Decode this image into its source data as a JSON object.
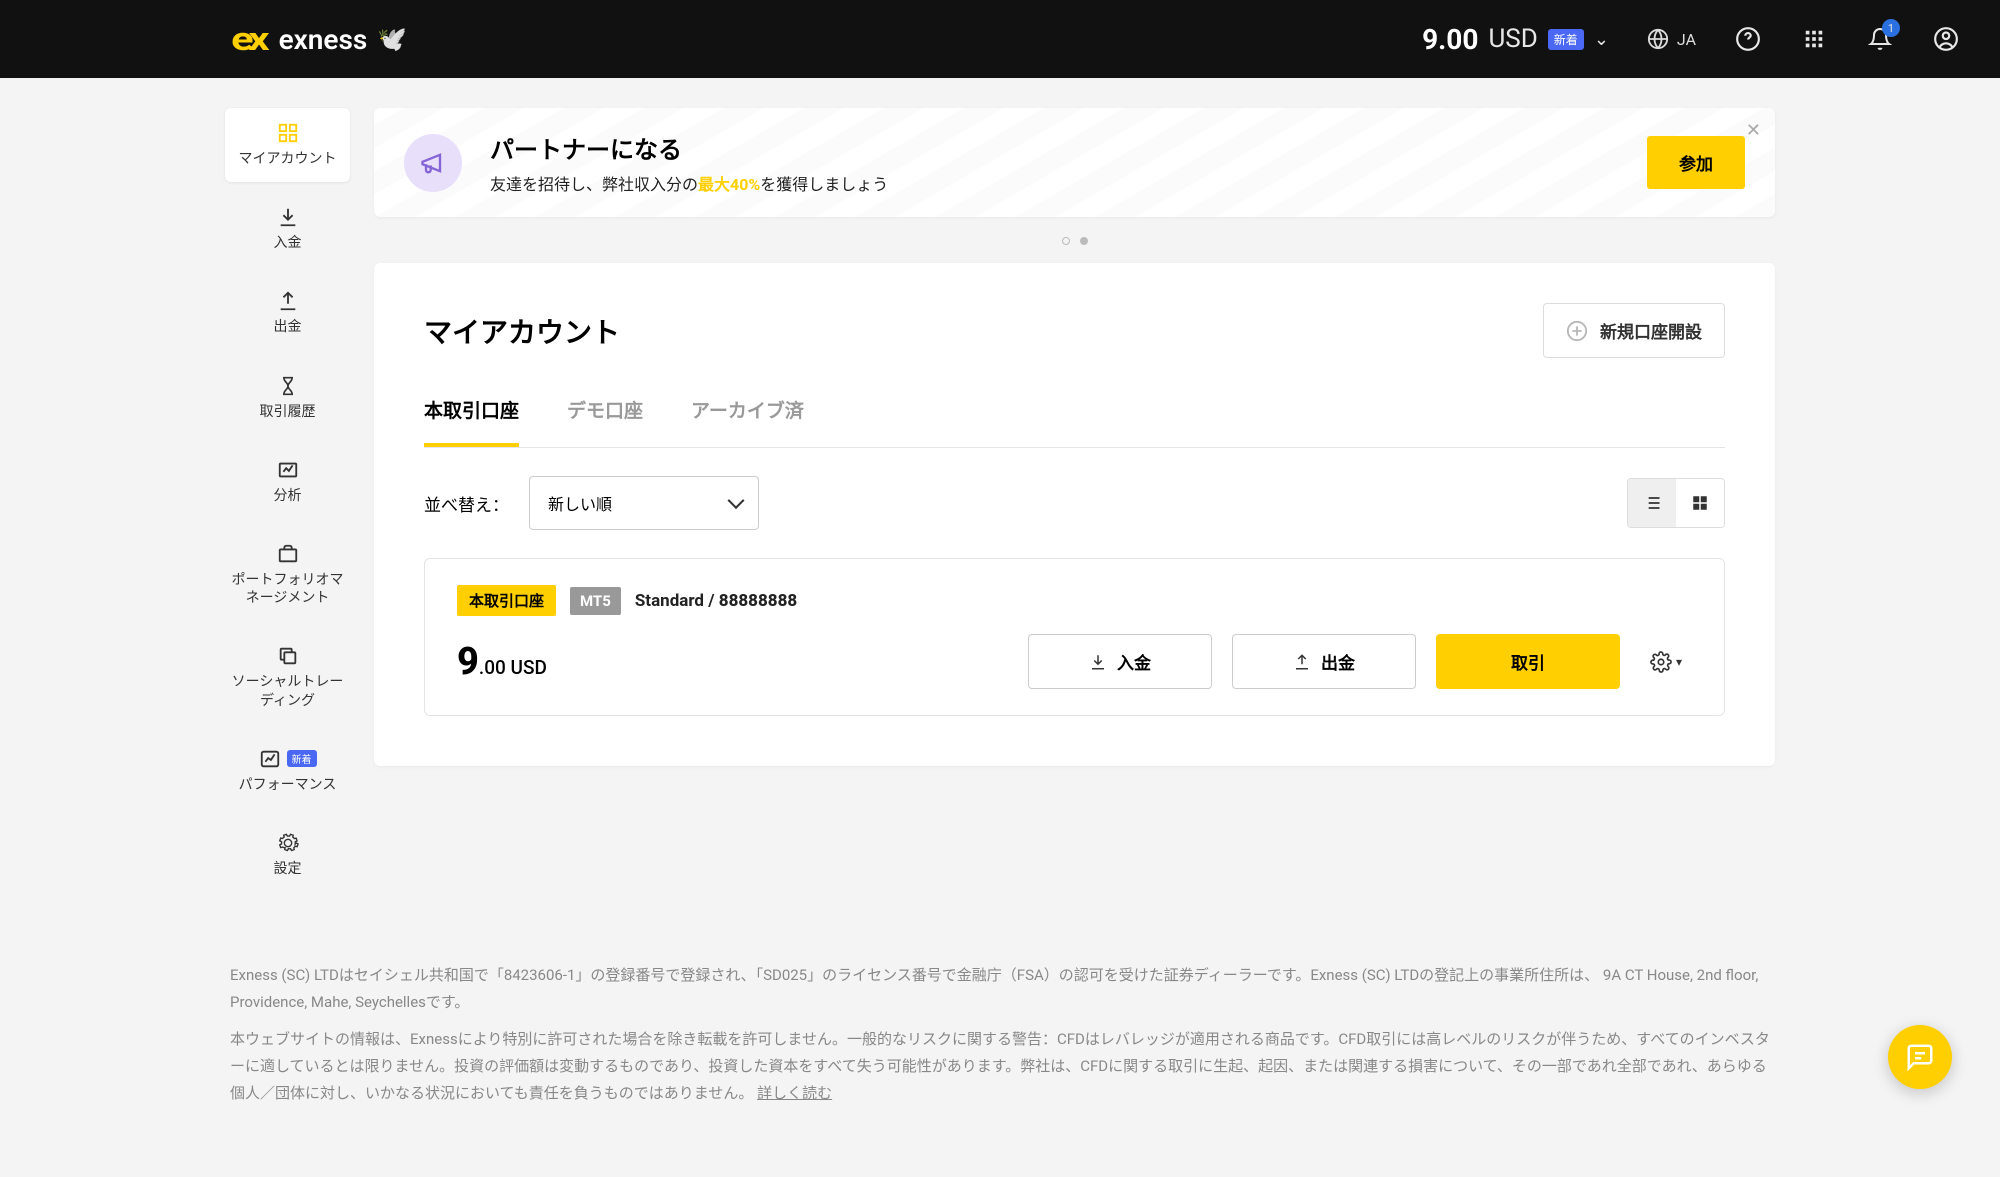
{
  "header": {
    "brand": "exness",
    "balance": "9.00",
    "currency": "USD",
    "new_badge": "新着",
    "language": "JA",
    "notif_count": "1"
  },
  "sidebar": {
    "items": [
      {
        "label": "マイアカウント"
      },
      {
        "label": "入金"
      },
      {
        "label": "出金"
      },
      {
        "label": "取引履歴"
      },
      {
        "label": "分析"
      },
      {
        "label": "ポートフォリオマネージメント"
      },
      {
        "label": "ソーシャルトレーディング"
      },
      {
        "label": "パフォーマンス",
        "badge": "新着"
      },
      {
        "label": "設定"
      }
    ]
  },
  "banner": {
    "title": "パートナーになる",
    "sub_pre": "友達を招待し、弊社収入分の",
    "sub_hl": "最大40%",
    "sub_post": "を獲得しましょう",
    "cta": "参加"
  },
  "card": {
    "title": "マイアカウント",
    "new_account": "新規口座開設",
    "tabs": [
      "本取引口座",
      "デモ口座",
      "アーカイブ済"
    ],
    "sort_label": "並べ替え：",
    "sort_value": "新しい順"
  },
  "account": {
    "tag_real": "本取引口座",
    "tag_platform": "MT5",
    "name_pre": "Standard /",
    "id": "88888888",
    "balance_whole": "9",
    "balance_dec": ".00",
    "balance_cur": "USD",
    "actions": {
      "deposit": "入金",
      "withdraw": "出金",
      "trade": "取引"
    }
  },
  "footer": {
    "p1": "Exness (SC) LTDはセイシェル共和国で「8423606-1」の登録番号で登録され、「SD025」のライセンス番号で金融庁（FSA）の認可を受けた証券ディーラーです。Exness (SC) LTDの登記上の事業所住所は、 9A CT House, 2nd floor, Providence, Mahe, Seychellesです。",
    "p2": "本ウェブサイトの情報は、Exnessにより特別に許可された場合を除き転載を許可しません。一般的なリスクに関する警告：CFDはレバレッジが適用される商品です。CFD取引には高レベルのリスクが伴うため、すべてのインベスターに適しているとは限りません。投資の評価額は変動するものであり、投資した資本をすべて失う可能性があります。弊社は、CFDに関する取引に生起、起因、または関連する損害について、その一部であれ全部であれ、あらゆる個人／団体に対し、いかなる状況においても責任を負うものではありません。",
    "more": "詳しく読む"
  }
}
